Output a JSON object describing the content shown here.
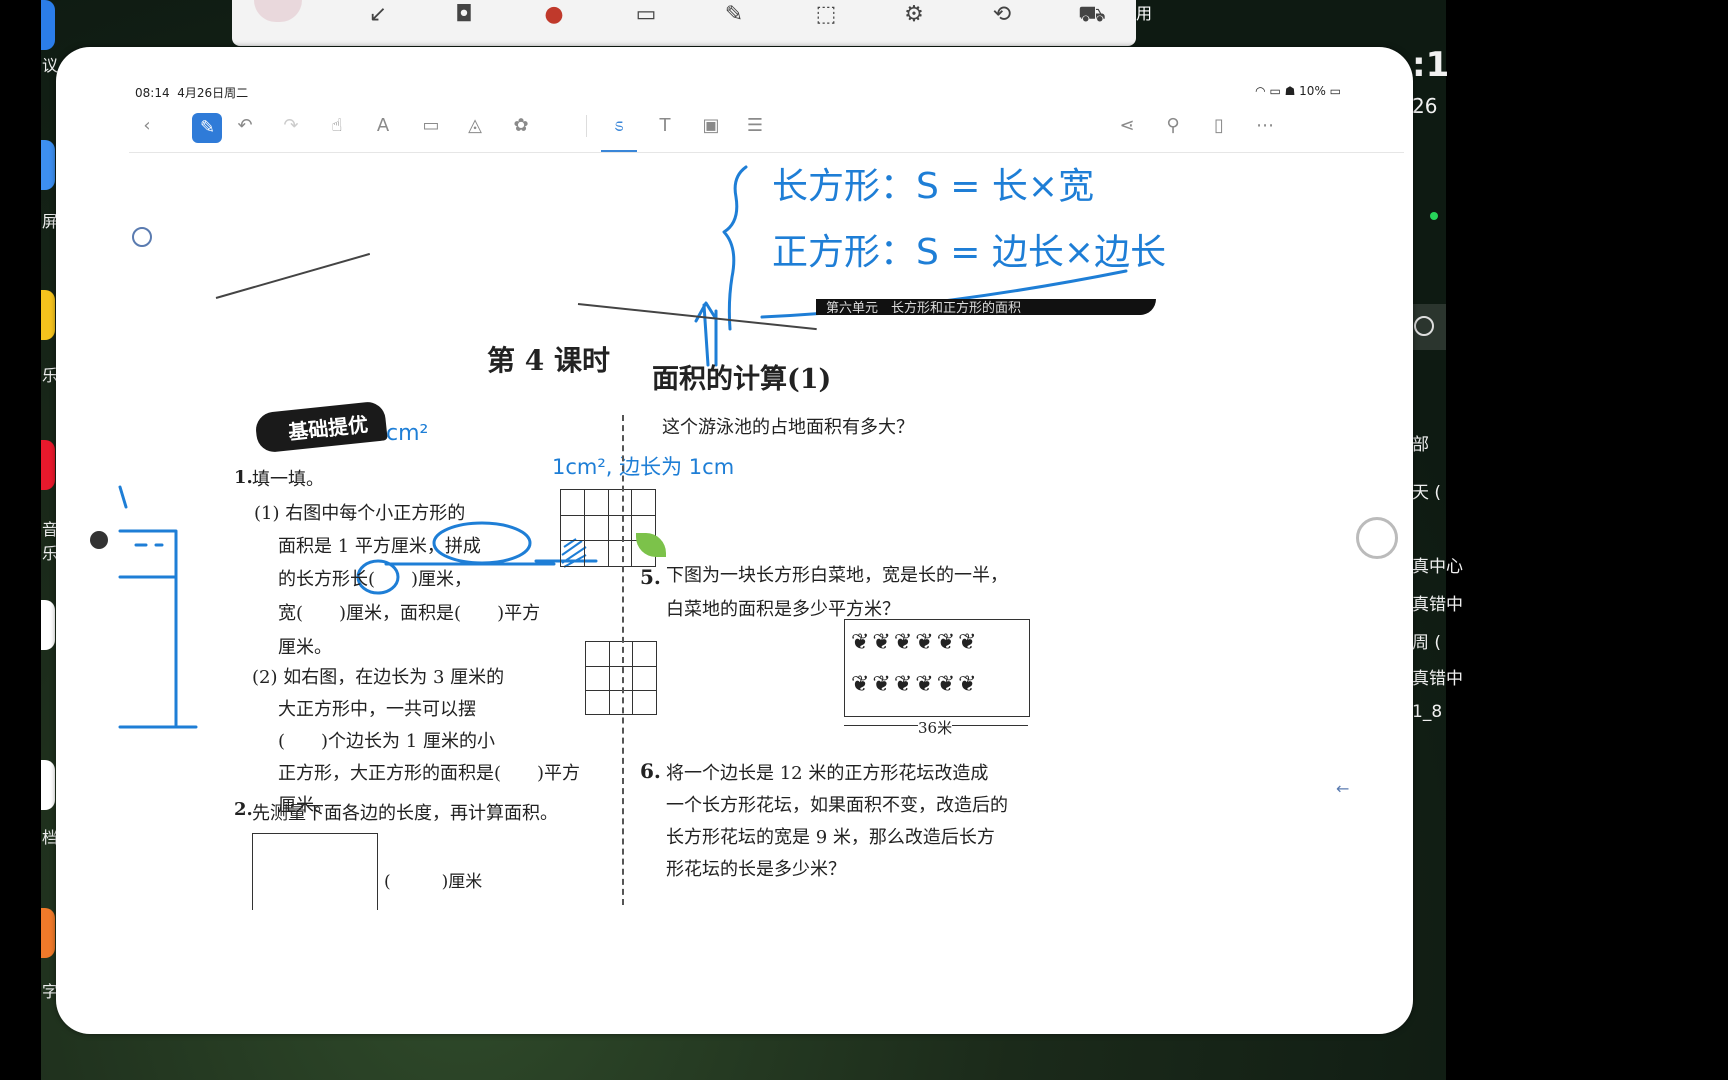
{
  "status_bar": {
    "time": "08:14",
    "date": "4月26日周二",
    "battery": "10%"
  },
  "left_dock": {
    "labels": [
      "议",
      "屏",
      "乐",
      "音乐",
      "档",
      "字"
    ]
  },
  "top_toolbar_right_label": "用",
  "right_panel": {
    "clock_partial": ":1",
    "date_partial": "26",
    "items": [
      "部",
      "天 (",
      "真中心",
      "真错中",
      "周 (",
      "真错中",
      "1_8"
    ]
  },
  "handwriting": {
    "rect_formula": "长方形：S = 长×宽",
    "square_formula": "正方形：S = 边长×边长",
    "note_1cm2": "1cm²",
    "note_side": "1cm², 边长为 1cm",
    "mark_1": "1"
  },
  "worksheet": {
    "unit_header": "第六单元　长方形和正方形的面积",
    "lesson_title": "第 4 课时",
    "lesson_subtitle": "面积的计算(1)",
    "badge": "基础提优",
    "q1": {
      "num": "1.",
      "title": "填一填。",
      "p1_l1": "(1) 右图中每个小正方形的",
      "p1_l2": "面积是 1 平方厘米，拼成",
      "p1_l3": "的长方形长(　　)厘米，",
      "p1_l4": "宽(　　)厘米，面积是(　　)平方",
      "p1_l5": "厘米。",
      "p2_l1": "(2) 如右图，在边长为 3 厘米的",
      "p2_l2": "大正方形中，一共可以摆",
      "p2_l3": "(　　)个边长为 1 厘米的小",
      "p2_l4": "正方形，大正方形的面积是(　　)平方",
      "p2_l5": "厘米。"
    },
    "q2": {
      "num": "2.",
      "text": "先测量下面各边的长度，再计算面积。",
      "answer_blank": "(　　　)厘米"
    },
    "q_pool": "这个游泳池的占地面积有多大？",
    "q5": {
      "num": "5.",
      "l1": "下图为一块长方形白菜地，宽是长的一半，",
      "l2": "白菜地的面积是多少平方米？",
      "dim": "36米"
    },
    "q6": {
      "num": "6.",
      "l1": "将一个边长是 12 米的正方形花坛改造成",
      "l2": "一个长方形花坛，如果面积不变，改造后的",
      "l3": "长方形花坛的宽是 9 米，那么改造后长方",
      "l4": "形花坛的长是多少米？"
    }
  },
  "colors": {
    "ink": "#1e7ed6",
    "accent": "#2f7bd8",
    "ipad_bg": "#ffffff"
  }
}
